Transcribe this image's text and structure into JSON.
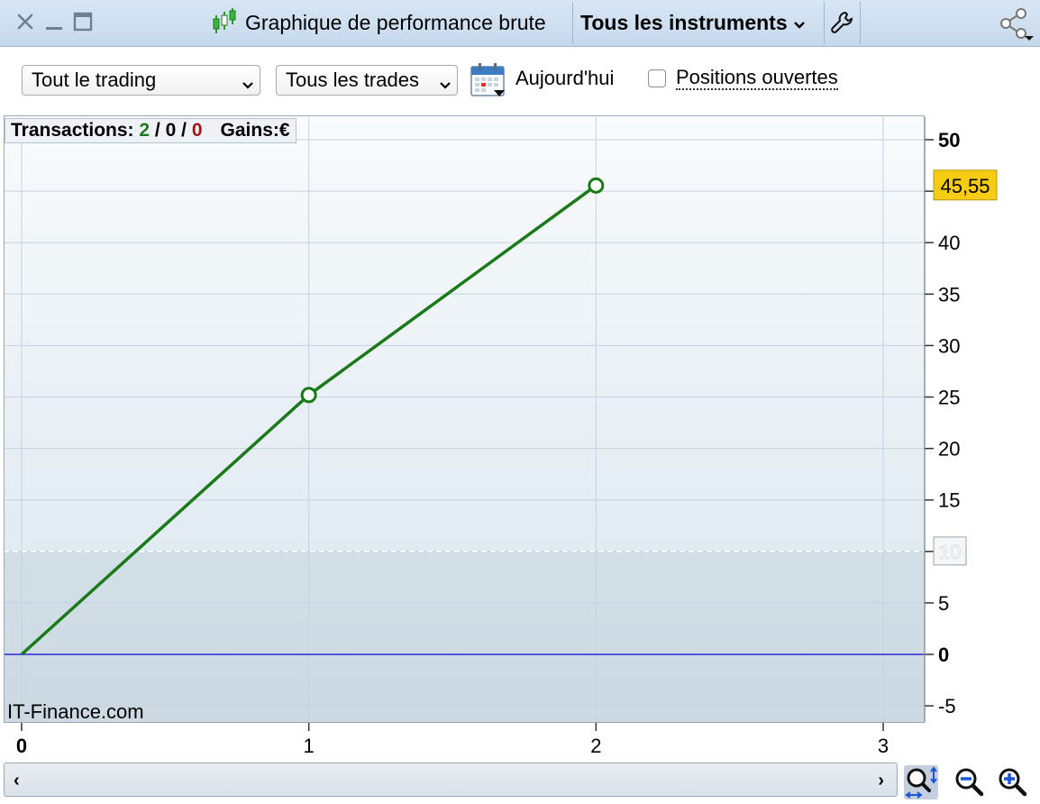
{
  "window": {
    "title": "Graphique de performance brute",
    "instrument_selector": "Tous les instruments",
    "icons": [
      "close-icon",
      "minimize-icon",
      "maximize-icon",
      "candlestick-icon",
      "chevron-down-icon",
      "wrench-icon",
      "share-icon"
    ]
  },
  "toolbar": {
    "trading_filter": "Tout le trading",
    "trade_filter": "Tous les trades",
    "date_label": "Aujourd'hui",
    "open_positions_label": "Positions ouvertes",
    "open_positions_checked": false
  },
  "stats": {
    "transactions_label": "Transactions:",
    "wins": "2",
    "sep1": "/",
    "neutral": "0",
    "sep2": "/",
    "losses": "0",
    "gains_label": "Gains:",
    "currency": "€"
  },
  "watermark": "IT-Finance.com",
  "colors": {
    "line": "#1a7a1a",
    "zero_line": "#2a2ad6",
    "last_value_badge": "#f5cc12",
    "win": "#1f7a1f",
    "loss": "#a31414"
  },
  "chart_data": {
    "type": "line",
    "x": [
      0,
      1,
      2
    ],
    "values": [
      0,
      25.2,
      45.55
    ],
    "xlim": [
      0,
      3
    ],
    "ylim": [
      -5,
      50
    ],
    "x_ticks": [
      "0",
      "1",
      "2",
      "3"
    ],
    "y_ticks": [
      "50",
      "45",
      "40",
      "35",
      "30",
      "25",
      "20",
      "15",
      "10",
      "5",
      "0",
      "-5"
    ],
    "last_value_label": "45,55",
    "reference_line_label": "10",
    "reference_line_value": 10,
    "zero_line_value": 0,
    "grid": true
  },
  "zoom_controls": [
    "zoom-fit-icon",
    "zoom-out-icon",
    "zoom-in-icon"
  ]
}
